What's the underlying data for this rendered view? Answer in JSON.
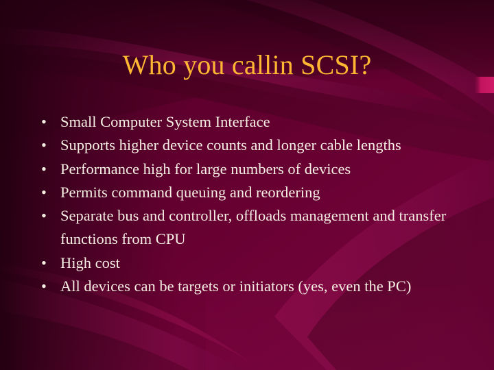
{
  "slide": {
    "title": "Who you callin SCSI?",
    "bullet_char": "•",
    "bullets": [
      {
        "text": "Small Computer System Interface"
      },
      {
        "text": "Supports higher device counts and longer cable lengths"
      },
      {
        "text": "Performance high for large numbers of devices"
      },
      {
        "text": "Permits command queuing and reordering"
      },
      {
        "text": "Separate bus and controller, offloads management and transfer functions from CPU"
      },
      {
        "text": "High cost"
      },
      {
        "text": "All devices can be targets or initiators (yes, even the PC)"
      }
    ]
  },
  "theme": {
    "background_base": "#5e002e",
    "background_dark": "#2a0016",
    "background_mid": "#660033",
    "ribbon_light": "#7d0a45",
    "ribbon_dark": "#46001f",
    "accent_bright": "#c2145e",
    "title_color": "#ffb733",
    "body_color": "#f5eee2"
  }
}
